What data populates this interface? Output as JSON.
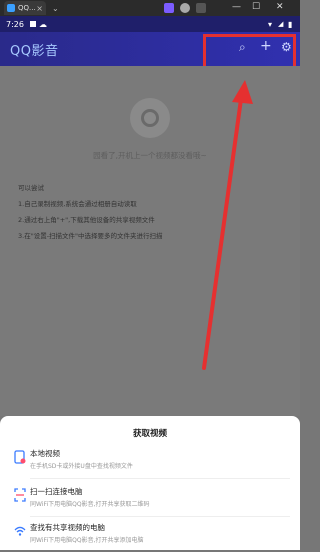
{
  "browser": {
    "tab_title": "QQ...",
    "tab_close": "×",
    "dropdown": "⌄",
    "win_min": "—",
    "win_max": "☐",
    "win_close": "✕"
  },
  "status": {
    "time": "7:26",
    "wifi": "▾",
    "battery": "▮"
  },
  "app": {
    "title": "QQ影音"
  },
  "empty": {
    "message": "园看了,开机上一个视频都没看哦~"
  },
  "tips": {
    "heading": "可以尝试",
    "items": [
      "1.自己录制视频,系统会通过相册自动读取",
      "2.通过右上角\"+\",下载其他设备的共享视频文件",
      "3.在\"设置-扫描文件\"中选择要多的文件夹进行扫描"
    ]
  },
  "sheet": {
    "title": "获取视频",
    "items": [
      {
        "label": "本地视频",
        "sub": "在手机SD卡或外接U盘中查找视频文件",
        "icon": "phone-icon"
      },
      {
        "label": "扫一扫连接电脑",
        "sub": "同WiFi下用电脑QQ影音,打开共享获取二维码",
        "icon": "scan-icon"
      },
      {
        "label": "查找有共享视频的电脑",
        "sub": "同WiFi下用电脑QQ影音,打开共享添加电脑",
        "icon": "wifi-icon"
      }
    ]
  },
  "colors": {
    "appbar": "#2e2ea0",
    "highlight": "#e53030",
    "accent": "#3a7bff"
  }
}
